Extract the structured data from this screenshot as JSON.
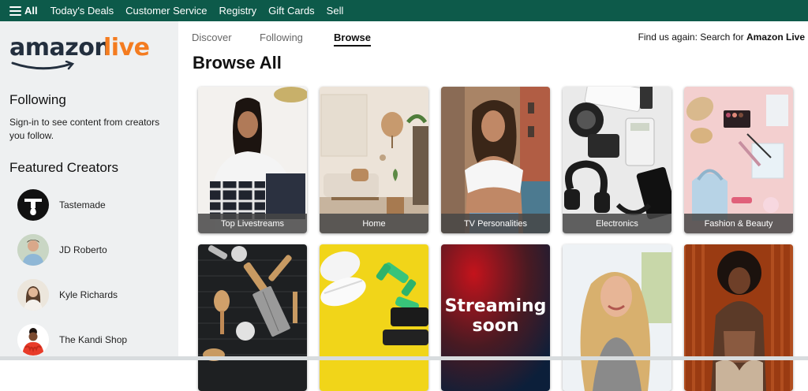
{
  "topnav": {
    "all_label": "All",
    "links": [
      "Today's Deals",
      "Customer Service",
      "Registry",
      "Gift Cards",
      "Sell"
    ],
    "background": "#0d5a4a"
  },
  "logo": {
    "word1": "amazon",
    "word2": "live",
    "accent": "#f47c20"
  },
  "sidebar": {
    "following_heading": "Following",
    "following_text": "Sign-in to see content from creators you follow.",
    "featured_heading": "Featured Creators",
    "creators": [
      {
        "name": "Tastemade",
        "icon": "tastemade-logo-icon"
      },
      {
        "name": "JD Roberto",
        "icon": "avatar"
      },
      {
        "name": "Kyle Richards",
        "icon": "avatar"
      },
      {
        "name": "The Kandi Shop",
        "icon": "avatar"
      }
    ]
  },
  "tabs": [
    {
      "label": "Discover",
      "active": false
    },
    {
      "label": "Following",
      "active": false
    },
    {
      "label": "Browse",
      "active": true
    }
  ],
  "findus": {
    "prefix": "Find us again: Search for ",
    "bold": "Amazon Live"
  },
  "browse_title": "Browse All",
  "tiles": [
    {
      "caption": "Top Livestreams"
    },
    {
      "caption": "Home"
    },
    {
      "caption": "TV Personalities"
    },
    {
      "caption": "Electronics"
    },
    {
      "caption": "Fashion & Beauty"
    },
    {
      "caption": ""
    },
    {
      "caption": ""
    },
    {
      "caption": "",
      "overlay": "Streaming soon"
    },
    {
      "caption": ""
    },
    {
      "caption": ""
    }
  ]
}
